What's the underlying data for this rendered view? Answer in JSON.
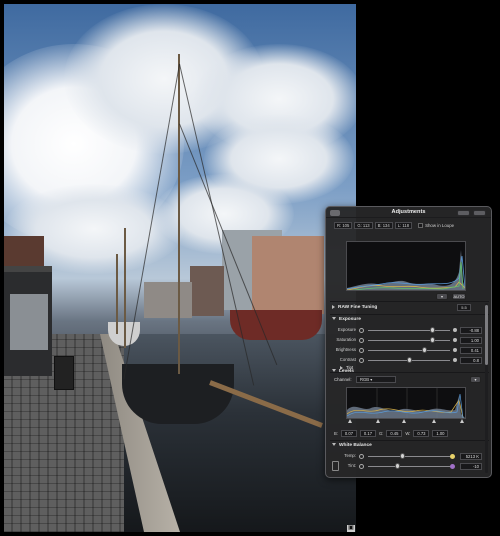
{
  "hud": {
    "title": "Adjustments",
    "rgb": {
      "r": "R: 105",
      "g": "G: 113",
      "b": "B: 134",
      "l": "L: 118"
    },
    "show_in_loupe": "Show in Loupe",
    "auto_btn": "AUTO",
    "raw_fine_tuning": {
      "label": "RAW Fine Tuning",
      "value": "5.5"
    },
    "exposure": {
      "label": "Exposure",
      "sliders": [
        {
          "label": "Exposure",
          "value": "-0.88",
          "position": 0.78
        },
        {
          "label": "Saturation",
          "value": "1.00",
          "position": 0.78
        },
        {
          "label": "Brightness",
          "value": "0.41",
          "position": 0.68
        },
        {
          "label": "Contrast",
          "value": "0.8",
          "position": 0.5
        }
      ],
      "tint_label": "Tint"
    },
    "levels": {
      "label": "Levels",
      "channel_label": "Channel:",
      "channel_value": "RGB",
      "values": [
        {
          "label": "B:",
          "value": "0.07"
        },
        {
          "label": "",
          "value": "0.17"
        },
        {
          "label": "G:",
          "value": "0.45"
        },
        {
          "label": "W:",
          "value": "0.73"
        },
        {
          "label": "",
          "value": "1.00"
        }
      ]
    },
    "white_balance": {
      "label": "White Balance",
      "sliders": [
        {
          "label": "Temp:",
          "value": "5213 K",
          "position": 0.42,
          "dot_color": "#e8d26a"
        },
        {
          "label": "Tint:",
          "value": "-10",
          "position": 0.36,
          "dot_color": "#a070c8"
        }
      ]
    }
  }
}
